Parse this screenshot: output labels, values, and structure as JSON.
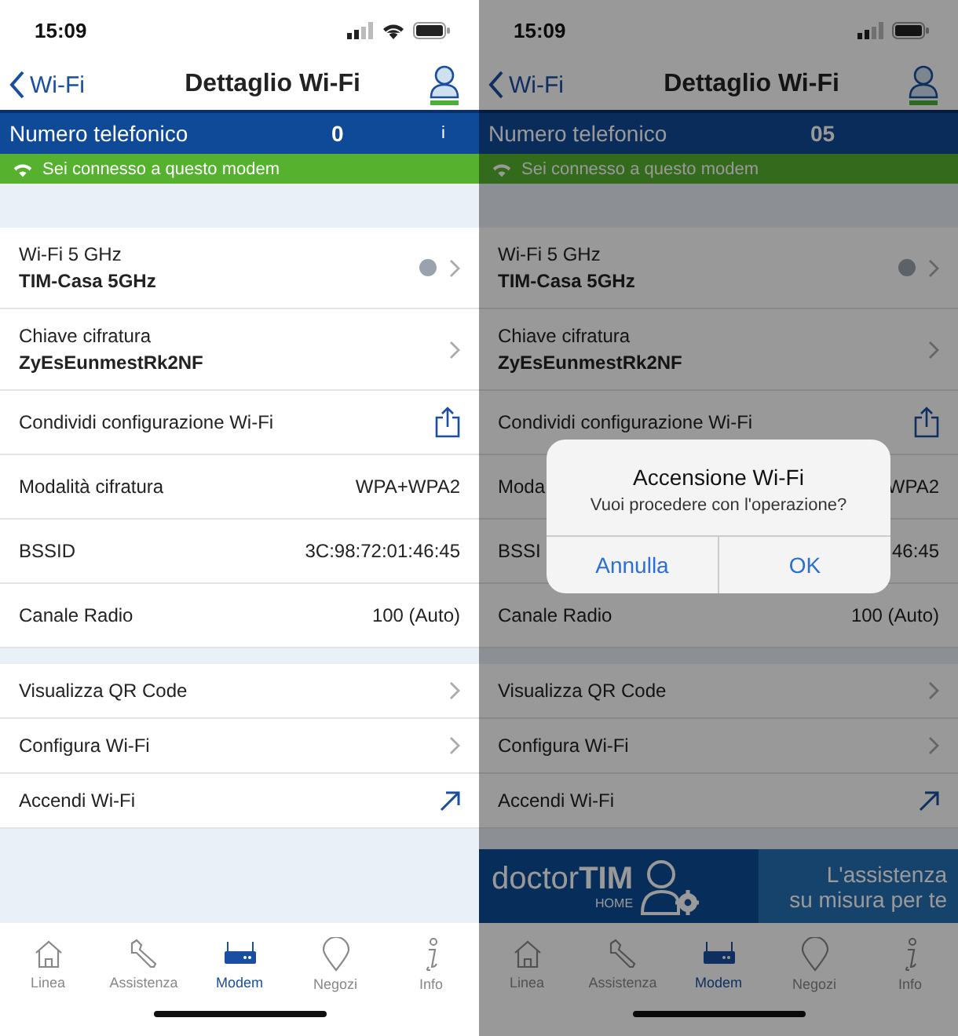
{
  "phones": [
    {
      "dimmed": false,
      "status_bar": {
        "time": "15:09",
        "wifi": true
      },
      "nav": {
        "back": "Wi-Fi",
        "title": "Dettaglio Wi-Fi"
      },
      "phone_bar": {
        "label": "Numero telefonico",
        "value": "0",
        "info": "i"
      },
      "connection_bar": {
        "text": "Sei connesso a questo modem"
      },
      "groups": [
        [
          {
            "kind": "detail",
            "label": "Wi-Fi 5 GHz",
            "value": "TIM-Casa 5GHz",
            "status_on": false
          },
          {
            "kind": "detail",
            "label": "Chiave cifratura",
            "value": "ZyEsEunmestRk2NF"
          },
          {
            "kind": "share",
            "label": "Condividi configurazione Wi-Fi"
          },
          {
            "kind": "value",
            "label": "Modalità cifratura",
            "value": "WPA+WPA2"
          },
          {
            "kind": "value",
            "label": "BSSID",
            "value": "3C:98:72:01:46:45"
          },
          {
            "kind": "value",
            "label": "Canale Radio",
            "value": "100 (Auto)"
          }
        ],
        [
          {
            "kind": "link",
            "label": "Visualizza QR Code"
          },
          {
            "kind": "link",
            "label": "Configura Wi-Fi"
          },
          {
            "kind": "external",
            "label": "Accendi Wi-Fi"
          }
        ]
      ],
      "tabs": [
        {
          "label": "Linea",
          "selected": false
        },
        {
          "label": "Assistenza",
          "selected": false
        },
        {
          "label": "Modem",
          "selected": true
        },
        {
          "label": "Negozi",
          "selected": false
        },
        {
          "label": "Info",
          "selected": false
        }
      ]
    },
    {
      "dimmed": true,
      "status_bar": {
        "time": "15:09",
        "wifi": false
      },
      "nav": {
        "back": "Wi-Fi",
        "title": "Dettaglio Wi-Fi"
      },
      "phone_bar": {
        "label": "Numero telefonico",
        "value": "05"
      },
      "connection_bar": {
        "text": "Sei connesso a questo modem"
      },
      "groups": [
        [
          {
            "kind": "detail",
            "label": "Wi-Fi 5 GHz",
            "value": "TIM-Casa 5GHz",
            "status_on": false
          },
          {
            "kind": "detail",
            "label": "Chiave cifratura",
            "value": "ZyEsEunmestRk2NF"
          },
          {
            "kind": "share",
            "label": "Condividi configurazione Wi-Fi"
          },
          {
            "kind": "value",
            "label": "Moda",
            "value": "WPA2"
          },
          {
            "kind": "value",
            "label": "BSSI",
            "value": "46:45"
          },
          {
            "kind": "value",
            "label": "Canale Radio",
            "value": "100 (Auto)"
          }
        ],
        [
          {
            "kind": "link",
            "label": "Visualizza QR Code"
          },
          {
            "kind": "link",
            "label": "Configura Wi-Fi"
          },
          {
            "kind": "external",
            "label": "Accendi Wi-Fi"
          }
        ]
      ],
      "banner": {
        "brand": "doctor**TIM**",
        "sub": "HOME",
        "line_1": "L'assistenza",
        "line_2": "su misura per te"
      },
      "alert": {
        "title": "Accensione Wi-Fi",
        "message": "Vuoi procedere con l'operazione?",
        "buttons": [
          "Annulla",
          "OK"
        ]
      },
      "tabs": [
        {
          "label": "Linea",
          "selected": false
        },
        {
          "label": "Assistenza",
          "selected": false
        },
        {
          "label": "Modem",
          "selected": true
        },
        {
          "label": "Negozi",
          "selected": false
        },
        {
          "label": "Info",
          "selected": false
        }
      ]
    }
  ]
}
